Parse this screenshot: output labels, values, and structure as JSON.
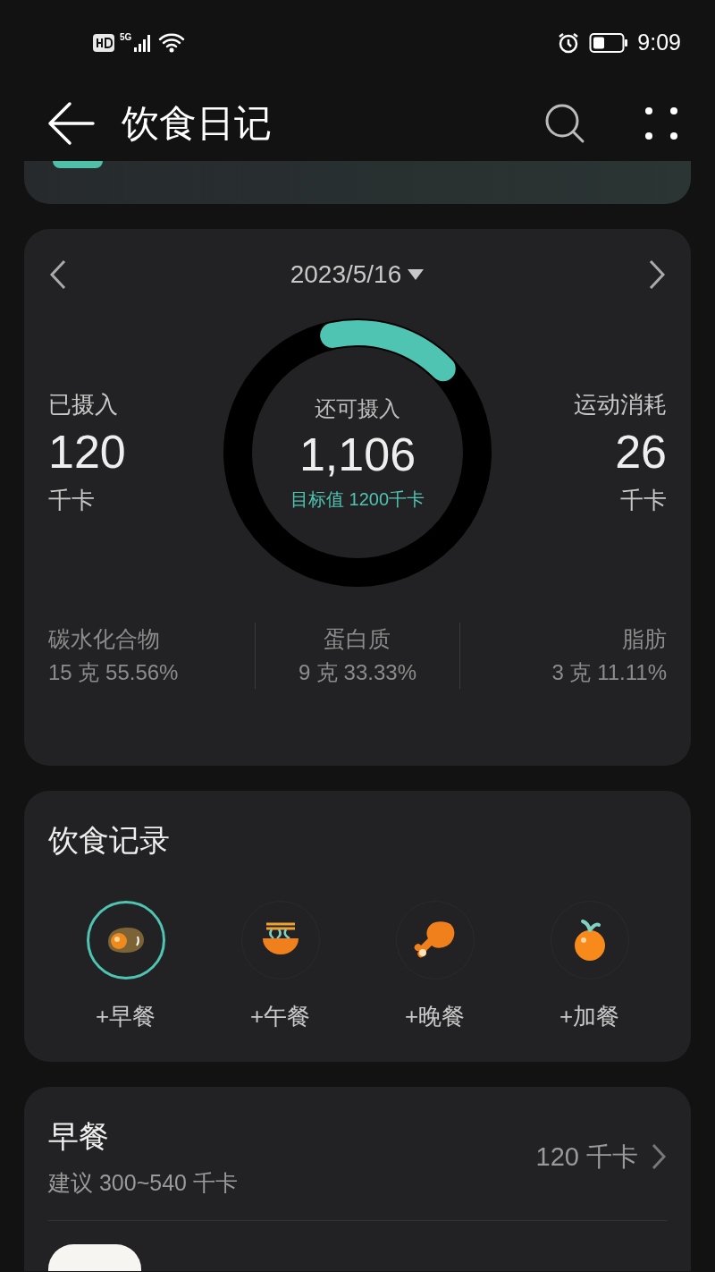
{
  "status_bar": {
    "time": "9:09",
    "network": "5G"
  },
  "header": {
    "title": "饮食日记"
  },
  "summary": {
    "date": "2023/5/16",
    "intake": {
      "label": "已摄入",
      "value": "120",
      "unit": "千卡"
    },
    "remaining": {
      "label": "还可摄入",
      "value": "1,106",
      "goal": "目标值 1200千卡",
      "level": 0.16
    },
    "burned": {
      "label": "运动消耗",
      "value": "26",
      "unit": "千卡"
    },
    "macros": [
      {
        "name": "碳水化合物",
        "amount": "15 克 55.56%"
      },
      {
        "name": "蛋白质",
        "amount": "9 克 33.33%"
      },
      {
        "name": "脂肪",
        "amount": "3 克 11.11%"
      }
    ]
  },
  "diet_record": {
    "title": "饮食记录",
    "meals": [
      {
        "label": "+早餐",
        "kind": "egg",
        "selected": true
      },
      {
        "label": "+午餐",
        "kind": "noodles",
        "selected": false
      },
      {
        "label": "+晚餐",
        "kind": "drumstick",
        "selected": false
      },
      {
        "label": "+加餐",
        "kind": "tangerine",
        "selected": false
      }
    ]
  },
  "breakfast": {
    "title": "早餐",
    "suggestion": "建议 300~540 千卡",
    "total": "120 千卡"
  }
}
